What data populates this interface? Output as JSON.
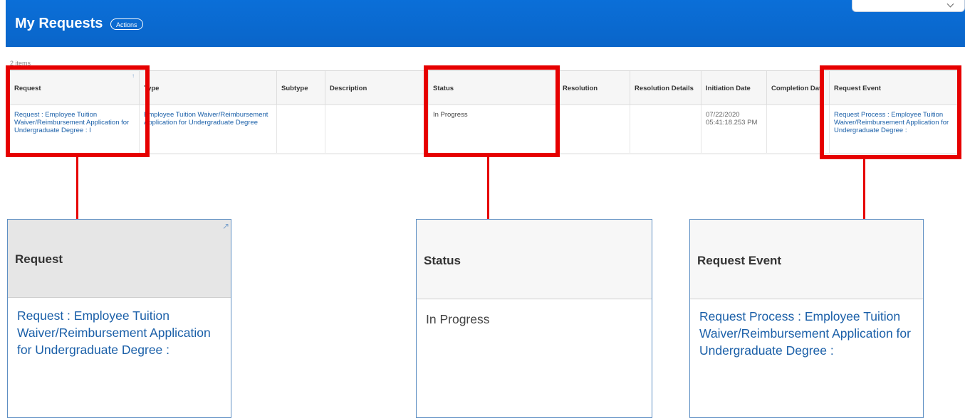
{
  "header": {
    "title": "My Requests",
    "actions_label": "Actions",
    "accent_color": "#0a6fd6"
  },
  "items_count": "2 items",
  "table": {
    "columns": [
      "Request",
      "Type",
      "Subtype",
      "Description",
      "Status",
      "Resolution",
      "Resolution Details",
      "Initiation Date",
      "Completion Dat",
      "Request Event"
    ],
    "row": {
      "request": "Request : Employee Tuition Waiver/Reimbursement Application for Undergraduate Degree : I",
      "type": "Employee Tuition Waiver/Reimbursement Application for Undergraduate Degree",
      "subtype": "",
      "description": "",
      "status": "In Progress",
      "resolution": "",
      "resolution_details": "",
      "initiation_date": "07/22/2020 05:41:18.253 PM",
      "completion_date": "",
      "request_event": "Request Process : Employee Tuition Waiver/Reimbursement Application for Undergraduate Degree :"
    }
  },
  "zoom_panels": {
    "request": {
      "header": "Request",
      "value": "Request : Employee Tuition Waiver/Reimbursement Application for Undergraduate Degree :"
    },
    "status": {
      "header": "Status",
      "value": "In Progress"
    },
    "request_event": {
      "header": "Request Event",
      "value": "Request Process : Employee Tuition Waiver/Reimbursement Application for Undergraduate Degree :"
    }
  },
  "highlight_color": "#e60000"
}
